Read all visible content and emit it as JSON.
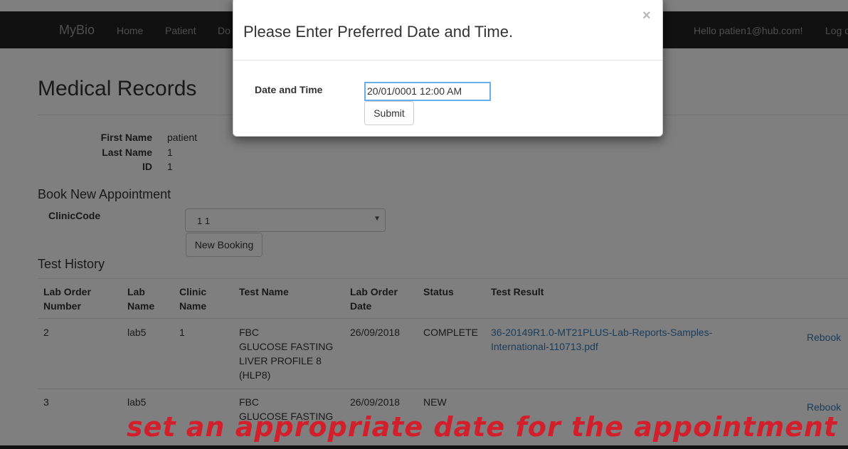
{
  "navbar": {
    "brand": "MyBio",
    "links": [
      "Home",
      "Patient",
      "Do"
    ],
    "user_greeting": "Hello patien1@hub.com!",
    "logout": "Log o"
  },
  "page": {
    "title": "Medical Records"
  },
  "patient": {
    "first_name_label": "First Name",
    "first_name": "patient",
    "last_name_label": "Last Name",
    "last_name": "1",
    "id_label": "ID",
    "id": "1"
  },
  "booking": {
    "title": "Book New Appointment",
    "clinic_label": "ClinicCode",
    "clinic_selected": "1 1",
    "new_booking": "New Booking"
  },
  "history": {
    "title": "Test History",
    "columns": [
      [
        "Lab Order",
        "Number"
      ],
      [
        "Lab",
        "Name"
      ],
      [
        "Clinic",
        "Name"
      ],
      [
        "Test Name",
        ""
      ],
      [
        "Lab Order",
        "Date"
      ],
      [
        "Status",
        ""
      ],
      [
        "Test Result",
        ""
      ]
    ],
    "rows": [
      {
        "order_number": "2",
        "lab_name": "lab5",
        "clinic_name": "1",
        "tests": [
          "FBC",
          "GLUCOSE FASTING",
          "LIVER PROFILE 8",
          "(HLP8)"
        ],
        "date": "26/09/2018",
        "status": "COMPLETE",
        "result": [
          "36-20149R1.0-MT21PLUS-Lab-Reports-Samples-",
          "International-110713.pdf"
        ],
        "action": "Rebook"
      },
      {
        "order_number": "3",
        "lab_name": "lab5",
        "clinic_name": "",
        "tests": [
          "FBC",
          "GLUCOSE FASTING",
          "",
          ""
        ],
        "date": "26/09/2018",
        "status": "NEW",
        "result": [
          "",
          ""
        ],
        "action": "Rebook"
      }
    ]
  },
  "modal": {
    "title": "Please Enter Preferred Date and Time.",
    "close_symbol": "×",
    "label": "Date and Time",
    "value": "20/01/0001 12:00 AM",
    "submit": "Submit"
  },
  "caption": "set an appropriate date for the appointment"
}
